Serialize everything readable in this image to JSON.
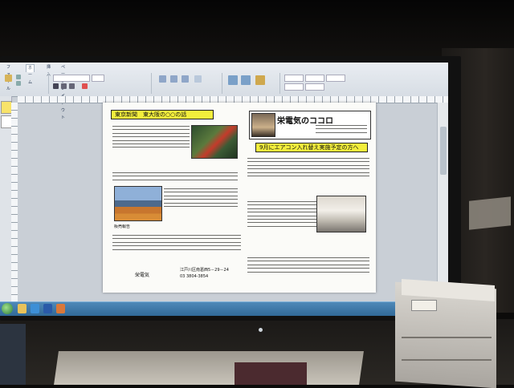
{
  "word_app": {
    "ribbon_tabs": [
      "ファイル",
      "ホーム",
      "挿入",
      "ページレイアウト",
      "参考資料",
      "差し込み文書",
      "校閲",
      "表示"
    ],
    "active_tab": "ホーム"
  },
  "newsletter": {
    "section1_heading": "東京新聞　東大阪の○○の話",
    "banner_title": "栄電気のココロ",
    "section2_heading": "9月にエアコン入れ替え実施予定の方へ",
    "section3_heading": "販売報告",
    "footer_company": "栄電気",
    "footer_address": "江戸川区南葛西5－29－24",
    "footer_phone": "03 3804-3854"
  },
  "colors": {
    "heading_yellow": "#f3ee3c",
    "taskbar_blue": "#2f6796",
    "ribbon_bg": "#e9edf2"
  },
  "icons": [
    "windows-start-icon",
    "explorer-icon",
    "ie-icon",
    "word-icon",
    "media-icon"
  ]
}
